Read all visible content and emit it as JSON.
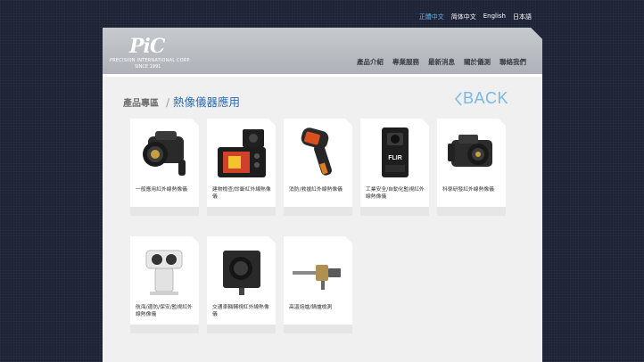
{
  "languages": [
    {
      "label": "正體中文",
      "active": true
    },
    {
      "label": "简体中文",
      "active": false
    },
    {
      "label": "English",
      "active": false
    },
    {
      "label": "日本語",
      "active": false
    }
  ],
  "brand": {
    "mark": "PiC",
    "line1": "PRECISION INTERNATIONAL CORP.",
    "line2": "SINCE 1991"
  },
  "nav": [
    "產品介紹",
    "專業服務",
    "最新消息",
    "關於儀測",
    "聯絡我們"
  ],
  "breadcrumb": {
    "zone": "產品專區",
    "separator": "/",
    "title": "熱像儀器應用"
  },
  "back_label": "BACK",
  "products": [
    {
      "label": "一般應用紅外線熱像儀",
      "icon": "handheld-camera-icon"
    },
    {
      "label": "建物檢查/診斷紅外線熱像儀",
      "icon": "compact-camera-icon"
    },
    {
      "label": "消防/救援紅外線熱像儀",
      "icon": "pistol-grip-camera-icon"
    },
    {
      "label": "工業安全/自動化監視紅外線熱像儀",
      "icon": "fixed-mount-camera-icon"
    },
    {
      "label": "科學研發紅外線熱像儀",
      "icon": "research-camera-icon"
    },
    {
      "label": "航海/邊防/保安/監視紅外線熱像儀",
      "icon": "ptz-camera-icon"
    },
    {
      "label": "交通車輛輔視紅外線熱像儀",
      "icon": "vehicle-core-camera-icon"
    },
    {
      "label": "高溫熔爐/鍋爐檢測",
      "icon": "furnace-probe-icon"
    }
  ]
}
